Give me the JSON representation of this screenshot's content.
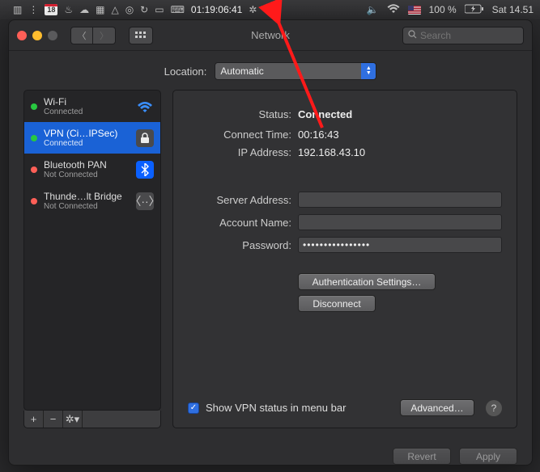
{
  "menubar": {
    "calendar_day": "18",
    "vpn_timer": "01:19:06:41",
    "battery_pct": "100 %",
    "clock": "Sat 14.51"
  },
  "window": {
    "title": "Network",
    "search_placeholder": "Search",
    "location_label": "Location:",
    "location_value": "Automatic"
  },
  "services": [
    {
      "name": "Wi-Fi",
      "status": "Connected",
      "dot": "green",
      "icon": "wifi"
    },
    {
      "name": "VPN (Ci…IPSec)",
      "status": "Connected",
      "dot": "green",
      "icon": "lock",
      "selected": true
    },
    {
      "name": "Bluetooth PAN",
      "status": "Not Connected",
      "dot": "red",
      "icon": "bt"
    },
    {
      "name": "Thunde…lt Bridge",
      "status": "Not Connected",
      "dot": "red",
      "icon": "tb"
    }
  ],
  "detail": {
    "status_label": "Status:",
    "status_value": "Connected",
    "connect_time_label": "Connect Time:",
    "connect_time_value": "00:16:43",
    "ip_label": "IP Address:",
    "ip_value": "192.168.43.10",
    "server_label": "Server Address:",
    "server_value": "",
    "account_label": "Account Name:",
    "account_value": "",
    "password_label": "Password:",
    "password_value": "••••••••••••••••",
    "auth_btn": "Authentication Settings…",
    "disconnect_btn": "Disconnect",
    "show_status_label": "Show VPN status in menu bar",
    "show_status_checked": true,
    "advanced_btn": "Advanced…"
  },
  "bottom": {
    "revert": "Revert",
    "apply": "Apply"
  }
}
